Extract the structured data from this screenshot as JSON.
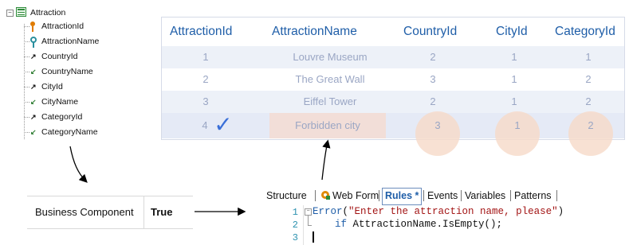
{
  "tree": {
    "root": "Attraction",
    "collapse_glyph": "−",
    "items": [
      {
        "label": "AttractionId",
        "icon": "primary-key-icon"
      },
      {
        "label": "AttractionName",
        "icon": "alternate-key-icon"
      },
      {
        "label": "CountryId",
        "icon": "foreign-key-arrow-icon"
      },
      {
        "label": "CountryName",
        "icon": "inferred-arrow-icon"
      },
      {
        "label": "CityId",
        "icon": "foreign-key-arrow-icon"
      },
      {
        "label": "CityName",
        "icon": "inferred-arrow-icon"
      },
      {
        "label": "CategoryId",
        "icon": "foreign-key-arrow-icon"
      },
      {
        "label": "CategoryName",
        "icon": "inferred-arrow-icon"
      }
    ]
  },
  "grid": {
    "headers": [
      "AttractionId",
      "AttractionName",
      "CountryId",
      "CityId",
      "CategoryId"
    ],
    "rows": [
      [
        "1",
        "Louvre Museum",
        "2",
        "1",
        "1"
      ],
      [
        "2",
        "The Great Wall",
        "3",
        "1",
        "2"
      ],
      [
        "3",
        "Eiffel Tower",
        "2",
        "1",
        "2"
      ],
      [
        "4",
        "Forbidden city",
        "3",
        "1",
        "2"
      ]
    ],
    "checkmark_glyph": "✓",
    "colors": {
      "header": "#1f5ea8",
      "cell": "#9aa6c4",
      "highlight": "#f4dcd2",
      "check": "#3a6fd8"
    }
  },
  "properties": {
    "name": "Business Component",
    "value": "True"
  },
  "editor": {
    "tabs": [
      "Structure",
      "Web Form",
      "Rules *",
      "Events",
      "Variables",
      "Patterns"
    ],
    "active_tab": "Rules *",
    "line_numbers": [
      "1",
      "2",
      "3"
    ],
    "code": {
      "line1_kw": "Error",
      "line1_open": "(",
      "line1_str": "\"Enter the attraction name, please\"",
      "line1_close": ")",
      "line2_kw": "if",
      "line2_rest": " AttractionName.IsEmpty();"
    }
  }
}
